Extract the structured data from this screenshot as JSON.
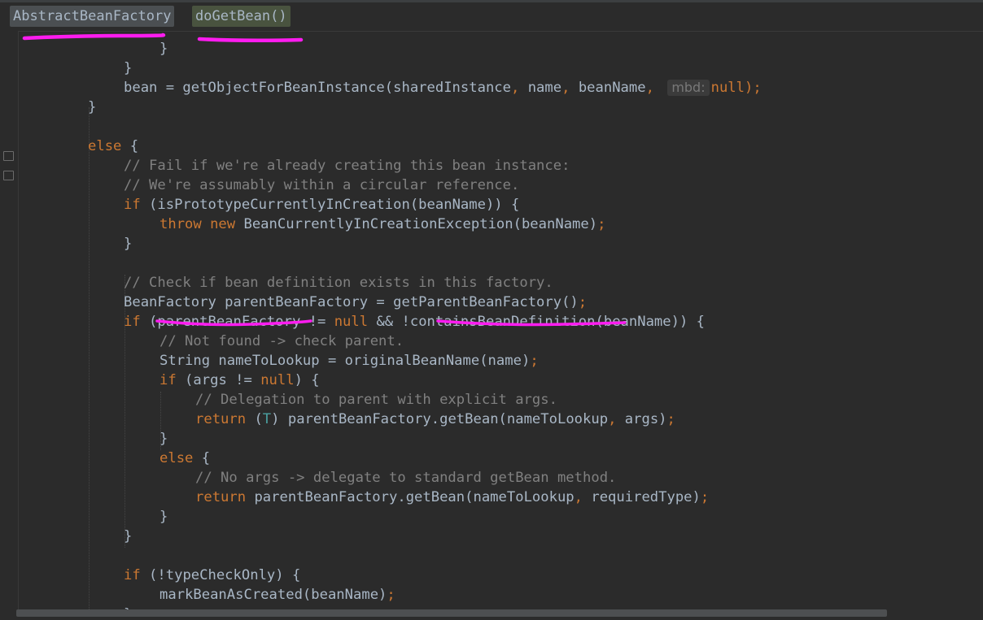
{
  "breadcrumb": {
    "class_name": "AbstractBeanFactory",
    "method_name": "doGetBean()"
  },
  "code": {
    "lines": [
      {
        "indent": 4,
        "tokens": [
          {
            "t": "}",
            "c": "p"
          }
        ]
      },
      {
        "indent": 3,
        "tokens": [
          {
            "t": "}",
            "c": "p"
          }
        ]
      },
      {
        "indent": 3,
        "tokens": [
          {
            "t": "bean = getObjectForBeanInstance(sharedInstance",
            "c": "p"
          },
          {
            "t": ", ",
            "c": "kw"
          },
          {
            "t": "name",
            "c": "p"
          },
          {
            "t": ", ",
            "c": "kw"
          },
          {
            "t": "beanName",
            "c": "p"
          },
          {
            "t": ", ",
            "c": "kw"
          },
          {
            "t": "mbd:",
            "c": "hint"
          },
          {
            "t": "null",
            "c": "kw"
          },
          {
            "t": ");",
            "c": "kw"
          }
        ]
      },
      {
        "indent": 2,
        "tokens": [
          {
            "t": "}",
            "c": "p"
          }
        ]
      },
      {
        "indent": 0,
        "tokens": []
      },
      {
        "indent": 2,
        "tokens": [
          {
            "t": "else ",
            "c": "kw"
          },
          {
            "t": "{",
            "c": "p"
          }
        ]
      },
      {
        "indent": 3,
        "tokens": [
          {
            "t": "// Fail if we're already creating this bean instance:",
            "c": "cm"
          }
        ]
      },
      {
        "indent": 3,
        "tokens": [
          {
            "t": "// We're assumably within a circular reference.",
            "c": "cm"
          }
        ]
      },
      {
        "indent": 3,
        "tokens": [
          {
            "t": "if ",
            "c": "kw"
          },
          {
            "t": "(isPrototypeCurrentlyInCreation(beanName)) {",
            "c": "p"
          }
        ]
      },
      {
        "indent": 4,
        "tokens": [
          {
            "t": "throw new ",
            "c": "kw"
          },
          {
            "t": "BeanCurrentlyInCreationException(beanName)",
            "c": "p"
          },
          {
            "t": ";",
            "c": "kw"
          }
        ]
      },
      {
        "indent": 3,
        "tokens": [
          {
            "t": "}",
            "c": "p"
          }
        ]
      },
      {
        "indent": 0,
        "tokens": []
      },
      {
        "indent": 3,
        "tokens": [
          {
            "t": "// Check if bean definition exists in this factory.",
            "c": "cm"
          }
        ]
      },
      {
        "indent": 3,
        "tokens": [
          {
            "t": "BeanFactory parentBeanFactory = getParentBeanFactory()",
            "c": "p"
          },
          {
            "t": ";",
            "c": "kw"
          }
        ]
      },
      {
        "indent": 3,
        "tokens": [
          {
            "t": "if ",
            "c": "kw"
          },
          {
            "t": "(parentBeanFactory != ",
            "c": "p"
          },
          {
            "t": "null ",
            "c": "kw"
          },
          {
            "t": "&& !containsBeanDefinition(beanName)) {",
            "c": "p"
          }
        ]
      },
      {
        "indent": 4,
        "tokens": [
          {
            "t": "// Not found -> check parent.",
            "c": "cm"
          }
        ]
      },
      {
        "indent": 4,
        "tokens": [
          {
            "t": "String nameToLookup = originalBeanName(name)",
            "c": "p"
          },
          {
            "t": ";",
            "c": "kw"
          }
        ]
      },
      {
        "indent": 4,
        "tokens": [
          {
            "t": "if ",
            "c": "kw"
          },
          {
            "t": "(args != ",
            "c": "p"
          },
          {
            "t": "null",
            "c": "kw"
          },
          {
            "t": ") {",
            "c": "p"
          }
        ]
      },
      {
        "indent": 5,
        "tokens": [
          {
            "t": "// Delegation to parent with explicit args.",
            "c": "cm"
          }
        ]
      },
      {
        "indent": 5,
        "tokens": [
          {
            "t": "return ",
            "c": "kw"
          },
          {
            "t": "(",
            "c": "p"
          },
          {
            "t": "T",
            "c": "tp"
          },
          {
            "t": ") parentBeanFactory.getBean(nameToLookup",
            "c": "p"
          },
          {
            "t": ", ",
            "c": "kw"
          },
          {
            "t": "args)",
            "c": "p"
          },
          {
            "t": ";",
            "c": "kw"
          }
        ]
      },
      {
        "indent": 4,
        "tokens": [
          {
            "t": "}",
            "c": "p"
          }
        ]
      },
      {
        "indent": 4,
        "tokens": [
          {
            "t": "else ",
            "c": "kw"
          },
          {
            "t": "{",
            "c": "p"
          }
        ]
      },
      {
        "indent": 5,
        "tokens": [
          {
            "t": "// No args -> delegate to standard getBean method.",
            "c": "cm"
          }
        ]
      },
      {
        "indent": 5,
        "tokens": [
          {
            "t": "return ",
            "c": "kw"
          },
          {
            "t": "parentBeanFactory.getBean(nameToLookup",
            "c": "p"
          },
          {
            "t": ", ",
            "c": "kw"
          },
          {
            "t": "requiredType)",
            "c": "p"
          },
          {
            "t": ";",
            "c": "kw"
          }
        ]
      },
      {
        "indent": 4,
        "tokens": [
          {
            "t": "}",
            "c": "p"
          }
        ]
      },
      {
        "indent": 3,
        "tokens": [
          {
            "t": "}",
            "c": "p"
          }
        ]
      },
      {
        "indent": 0,
        "tokens": []
      },
      {
        "indent": 3,
        "tokens": [
          {
            "t": "if ",
            "c": "kw"
          },
          {
            "t": "(!typeCheckOnly) {",
            "c": "p"
          }
        ]
      },
      {
        "indent": 4,
        "tokens": [
          {
            "t": "markBeanAsCreated(beanName)",
            "c": "p"
          },
          {
            "t": ";",
            "c": "kw"
          }
        ]
      },
      {
        "indent": 3,
        "tokens": [
          {
            "t": "}",
            "c": "p"
          }
        ]
      }
    ]
  },
  "colors": {
    "keyword": "#cc7832",
    "plain": "#a9b7c6",
    "comment": "#808080",
    "type_param": "#4aa0a0",
    "annotation_marker": "#ff1cf0",
    "background": "#2b2b2b"
  },
  "icons": [
    "fold-open-icon",
    "fold-close-icon"
  ]
}
